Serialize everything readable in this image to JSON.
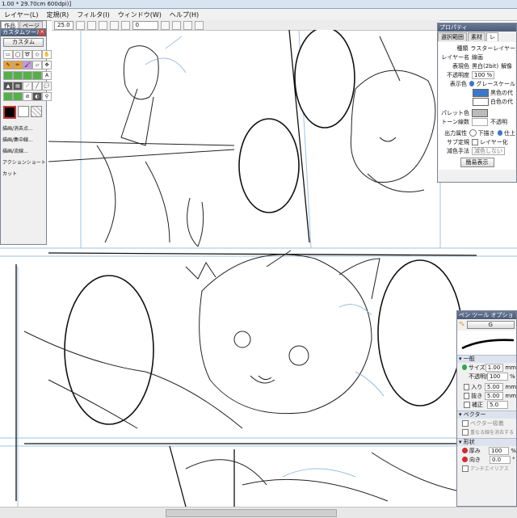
{
  "window": {
    "title": "1.00 * 29.70cm 600dpi)]"
  },
  "menu": [
    "レイヤー(L)",
    "定規(R)",
    "フィルタ(I)",
    "ウィンドウ(W)",
    "ヘルプ(H)"
  ],
  "toolbar": {
    "zoom": "25.0",
    "rotate": "0"
  },
  "tool_panel": {
    "title": "カスタムツール",
    "tabs": [
      "作品",
      "ページ"
    ],
    "preset": "カスタム",
    "actions": [
      "描画/消去点...",
      "描画/集中線...",
      "描画/流線...",
      "アクションショートカット"
    ]
  },
  "properties": {
    "title": "プロパティ",
    "tabs": [
      "選択範囲",
      "素材",
      "レ"
    ],
    "rows": [
      {
        "label": "種類",
        "value": "ラスターレイヤー"
      },
      {
        "label": "レイヤー名",
        "value": "線画"
      },
      {
        "label": "表現色",
        "value": "黒白(2bit)"
      },
      {
        "label": "",
        "value": "解像"
      },
      {
        "label": "不透明度",
        "value": "100 %"
      },
      {
        "label": "表示色",
        "value": "グレースケール"
      }
    ],
    "color_items": [
      "黒色の代",
      "白色の代"
    ],
    "palette_label": "パレット色",
    "tone_label": "トーン線数",
    "opacity_short": "不透明",
    "output_label": "出力属性",
    "output_opts": [
      "下描き",
      "仕上"
    ],
    "sub_label": "サブ定規",
    "sub_opt": "レイヤー化",
    "reduce_label": "減色手法",
    "reduce_value": "減色しない",
    "hide_button": "簡易表示",
    "accent": "#3a78c9"
  },
  "pen_options": {
    "title": "ペン ツール オプション",
    "preset": "G",
    "general_label": "一般",
    "size_label": "サイズ",
    "size_value": "1.00",
    "size_unit": "mm",
    "opacity_label": "不透明度",
    "opacity_value": "100",
    "opacity_unit": "%",
    "in_label": "入り",
    "in_value": "5.00",
    "in_unit": "mm",
    "out_label": "抜き",
    "out_value": "5.00",
    "out_unit": "mm",
    "correct_label": "補正",
    "correct_value": "5.0",
    "vector_label": "ベクター",
    "vector_erase": "ベクター吸着",
    "vector_overlap": "重なる線を消去する",
    "shape_label": "形状",
    "thick_label": "厚み",
    "thick_value": "100",
    "thick_unit": "%",
    "dir_label": "向き",
    "dir_value": "0.0",
    "dir_unit": "°",
    "antialias": "アンチエイリアス"
  }
}
